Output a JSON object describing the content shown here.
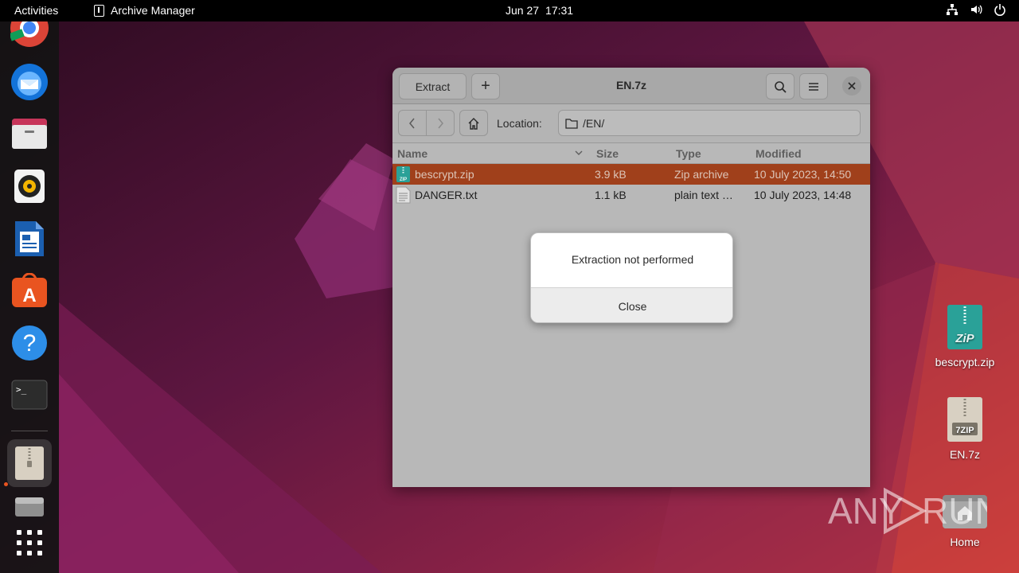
{
  "topbar": {
    "activities": "Activities",
    "app_name": "Archive Manager",
    "date": "Jun 27",
    "time": "17:31"
  },
  "dock": {
    "items": [
      "chrome-icon",
      "thunderbird-icon",
      "files-icon",
      "rhythmbox-icon",
      "libreoffice-writer-icon",
      "app-center-icon",
      "help-icon",
      "terminal-icon",
      "archive-manager-icon",
      "removable-drive-icon",
      "show-apps-icon"
    ]
  },
  "desktop": {
    "icons": [
      {
        "label": "bescrypt.zip",
        "badge": "ZiP"
      },
      {
        "label": "EN.7z",
        "badge": "7ZIP"
      },
      {
        "label": "Home"
      }
    ]
  },
  "window": {
    "title": "EN.7z",
    "extract_label": "Extract",
    "add_label": "+",
    "location_label": "Location:",
    "location_value": "/EN/",
    "columns": {
      "name": "Name",
      "size": "Size",
      "type": "Type",
      "modified": "Modified"
    },
    "files": [
      {
        "name": "bescrypt.zip",
        "size": "3.9 kB",
        "type": "Zip archive",
        "modified": "10 July 2023, 14:50",
        "selected": true
      },
      {
        "name": "DANGER.txt",
        "size": "1.1 kB",
        "type": "plain text …",
        "modified": "10 July 2023, 14:48",
        "selected": false
      }
    ]
  },
  "dialog": {
    "message": "Extraction not performed",
    "close_label": "Close"
  },
  "watermark": {
    "text_left": "ANY",
    "text_right": "RUN"
  },
  "colors": {
    "selection": "#a0401b",
    "accent": "#e95420",
    "wallpaper_dark": "#3b0f2a",
    "wallpaper_light": "#c8303f"
  }
}
